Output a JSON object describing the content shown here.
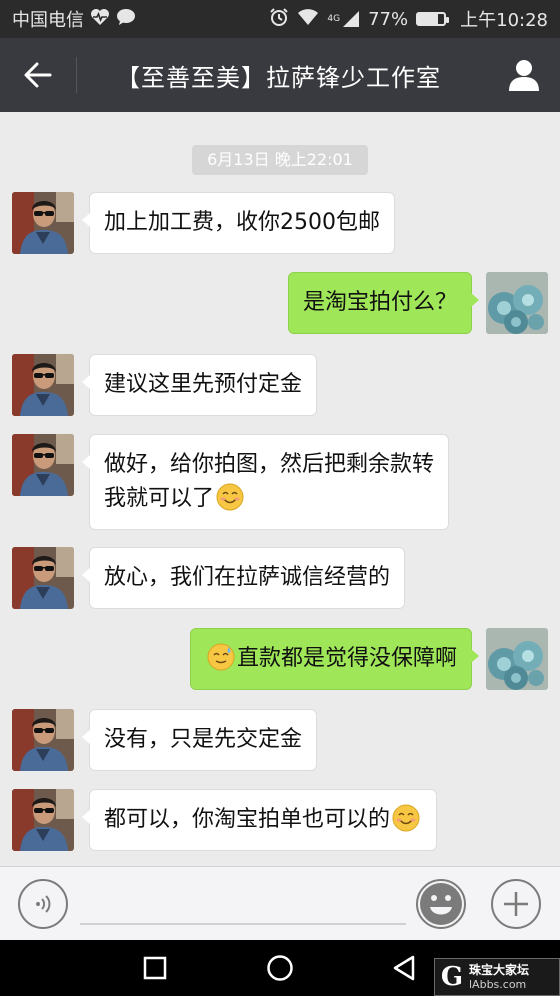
{
  "status_bar": {
    "carrier": "中国电信",
    "network": "4G",
    "battery": "77%",
    "battery_level": 0.77,
    "time": "上午10:28",
    "icons": [
      "heart-pulse-icon",
      "chat-bubble-icon",
      "alarm-icon",
      "wifi-icon",
      "signal-icon",
      "battery-icon"
    ]
  },
  "header": {
    "title": "【至善至美】拉萨锋少工作室",
    "back_icon": "arrow-left-icon",
    "profile_icon": "person-icon",
    "bg_color": "#393a3f"
  },
  "chat": {
    "timestamp": "6月13日 晚上22:01",
    "bubble_in_color": "#ffffff",
    "bubble_out_color": "#9fe658",
    "messages": [
      {
        "dir": "in",
        "text": "加上加工费，收你2500包邮"
      },
      {
        "dir": "out",
        "text": "是淘宝拍付么？"
      },
      {
        "dir": "in",
        "text": "建议这里先预付定金"
      },
      {
        "dir": "in",
        "line1": "做好，给你拍图，然后把剩余款转",
        "line2": "我就可以了",
        "emoji": "smile-emoji"
      },
      {
        "dir": "in",
        "text": "放心，我们在拉萨诚信经营的"
      },
      {
        "dir": "out",
        "emoji": "sweat-smile-emoji",
        "text": "直款都是觉得没保障啊"
      },
      {
        "dir": "in",
        "text": "没有，只是先交定金"
      },
      {
        "dir": "in",
        "text": "都可以，你淘宝拍单也可以的",
        "emoji": "smile-emoji"
      }
    ]
  },
  "input_bar": {
    "voice_icon": "voice-icon",
    "emoji_icon": "emoji-face-icon",
    "plus_icon": "plus-icon"
  },
  "nav_bar": {
    "icons": [
      "square-recent-icon",
      "circle-home-icon",
      "triangle-back-icon"
    ]
  },
  "watermark": {
    "letter": "G",
    "line1": "珠宝大家坛",
    "line2": "lAbbs.com"
  }
}
